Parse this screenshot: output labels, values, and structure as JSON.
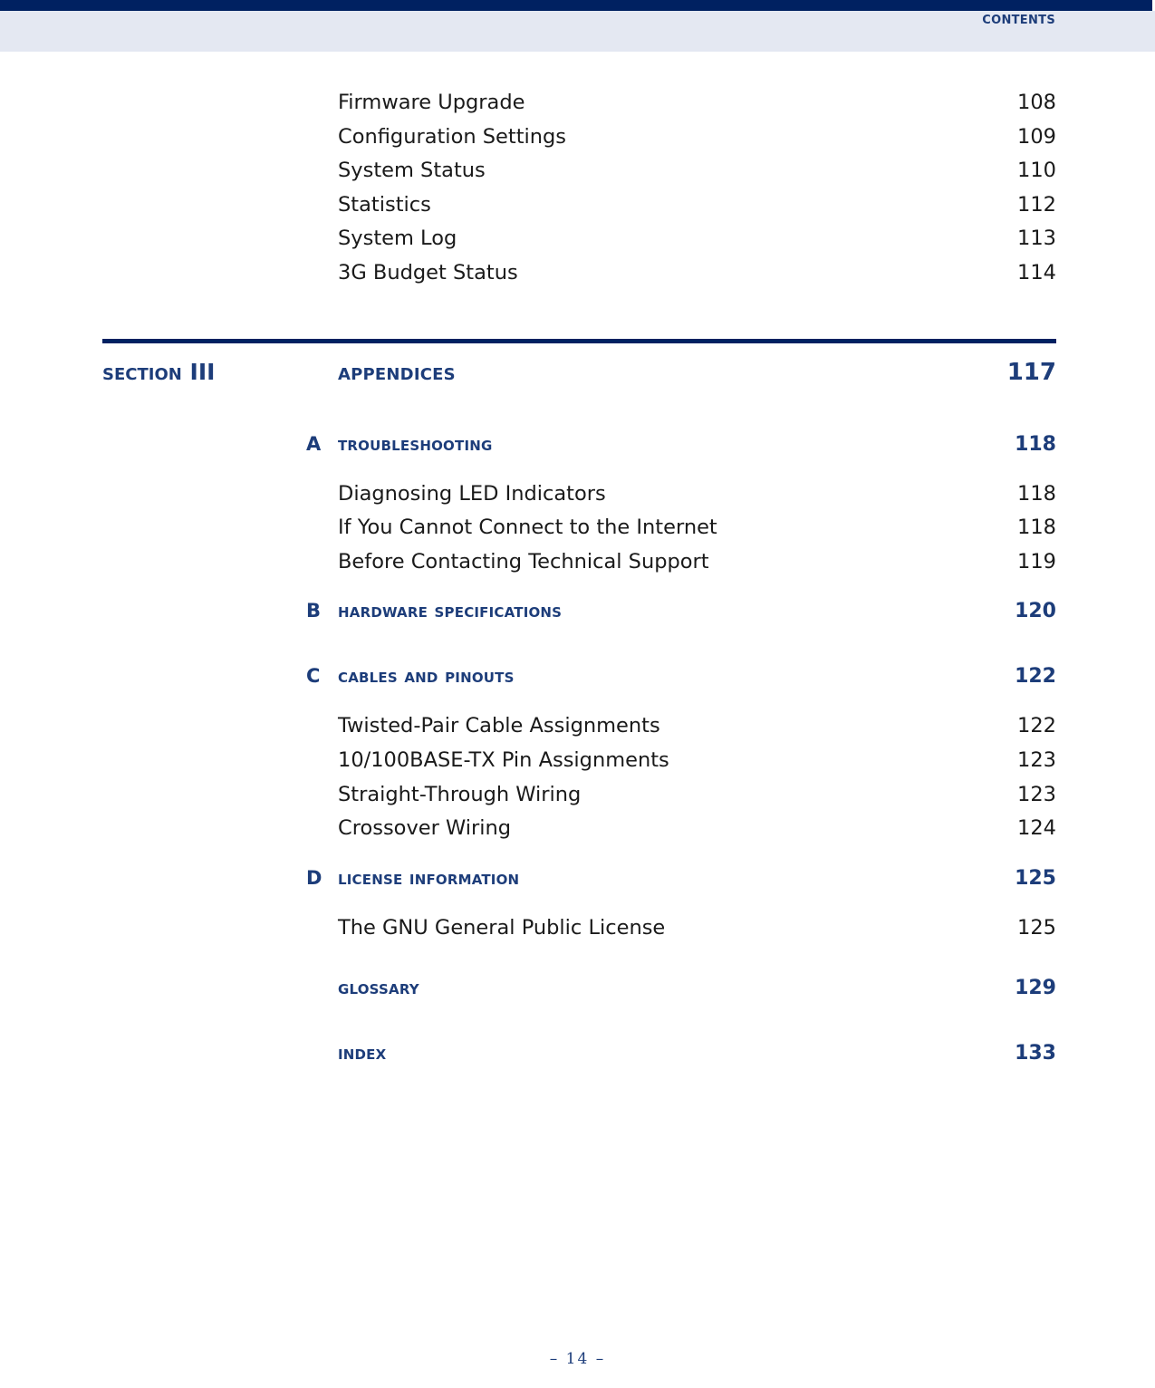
{
  "header": {
    "title": "Contents"
  },
  "toc": {
    "leading_entries": [
      {
        "label": "Firmware Upgrade",
        "page": "108"
      },
      {
        "label": "Configuration Settings",
        "page": "109"
      },
      {
        "label": "System Status",
        "page": "110"
      },
      {
        "label": "Statistics",
        "page": "112"
      },
      {
        "label": "System Log",
        "page": "113"
      },
      {
        "label": "3G Budget Status",
        "page": "114"
      }
    ],
    "section": {
      "name_word": "Section",
      "name_number": "III",
      "title": "Appendices",
      "page": "117"
    },
    "appendices": [
      {
        "letter": "A",
        "title": "Troubleshooting",
        "page": "118",
        "entries": [
          {
            "label": "Diagnosing LED Indicators",
            "page": "118"
          },
          {
            "label": "If You Cannot Connect to the Internet",
            "page": "118"
          },
          {
            "label": "Before Contacting Technical Support",
            "page": "119"
          }
        ]
      },
      {
        "letter": "B",
        "title": "Hardware Specifications",
        "page": "120",
        "entries": []
      },
      {
        "letter": "C",
        "title": "Cables and Pinouts",
        "page": "122",
        "entries": [
          {
            "label": "Twisted-Pair Cable Assignments",
            "page": "122"
          },
          {
            "label": "10/100BASE-TX Pin Assignments",
            "page": "123"
          },
          {
            "label": "Straight-Through Wiring",
            "page": "123"
          },
          {
            "label": "Crossover Wiring",
            "page": "124"
          }
        ]
      },
      {
        "letter": "D",
        "title": "License Information",
        "page": "125",
        "entries": [
          {
            "label": "The GNU General Public License",
            "page": "125"
          }
        ]
      }
    ],
    "back_matter": [
      {
        "letter": "",
        "title": "Glossary",
        "page": "129"
      },
      {
        "letter": "",
        "title": "Index",
        "page": "133"
      }
    ]
  },
  "footer": {
    "page_marker": "–  14  –"
  }
}
